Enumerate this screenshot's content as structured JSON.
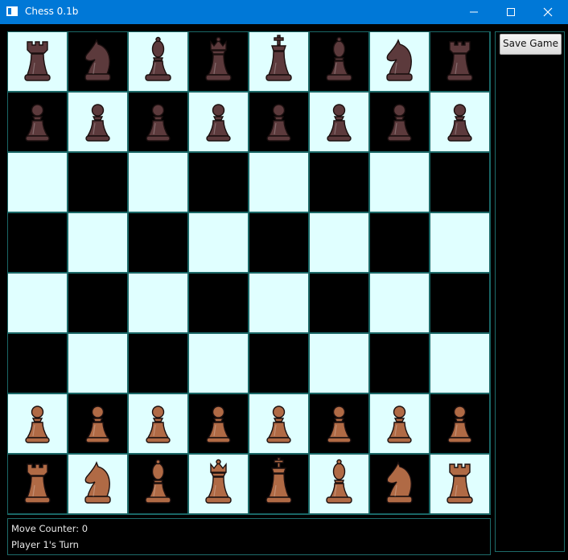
{
  "window": {
    "title": "Chess 0.1b",
    "controls": [
      "minimize",
      "maximize",
      "close"
    ]
  },
  "colors": {
    "titlebar": "#0078d7",
    "square_light": "#e0ffff",
    "square_dark": "#000000",
    "board_lines": "#1a6766",
    "player_two_pieces": "#5c3a3c",
    "player_one_pieces": "#b06a45"
  },
  "board": {
    "rows": [
      [
        "rook-dark",
        "knight-dark",
        "bishop-dark",
        "queen-dark",
        "king-dark",
        "bishop-dark",
        "knight-dark",
        "rook-dark"
      ],
      [
        "pawn-dark",
        "pawn-dark",
        "pawn-dark",
        "pawn-dark",
        "pawn-dark",
        "pawn-dark",
        "pawn-dark",
        "pawn-dark"
      ],
      [
        "",
        "",
        "",
        "",
        "",
        "",
        "",
        ""
      ],
      [
        "",
        "",
        "",
        "",
        "",
        "",
        "",
        ""
      ],
      [
        "",
        "",
        "",
        "",
        "",
        "",
        "",
        ""
      ],
      [
        "",
        "",
        "",
        "",
        "",
        "",
        "",
        ""
      ],
      [
        "pawn-light",
        "pawn-light",
        "pawn-light",
        "pawn-light",
        "pawn-light",
        "pawn-light",
        "pawn-light",
        "pawn-light"
      ],
      [
        "rook-light",
        "knight-light",
        "bishop-light",
        "queen-light",
        "king-light",
        "bishop-light",
        "knight-light",
        "rook-light"
      ]
    ]
  },
  "status": {
    "move_counter": "Move Counter: 0",
    "turn": "Player 1's Turn"
  },
  "side_panel": {
    "save_label": "Save Game"
  }
}
